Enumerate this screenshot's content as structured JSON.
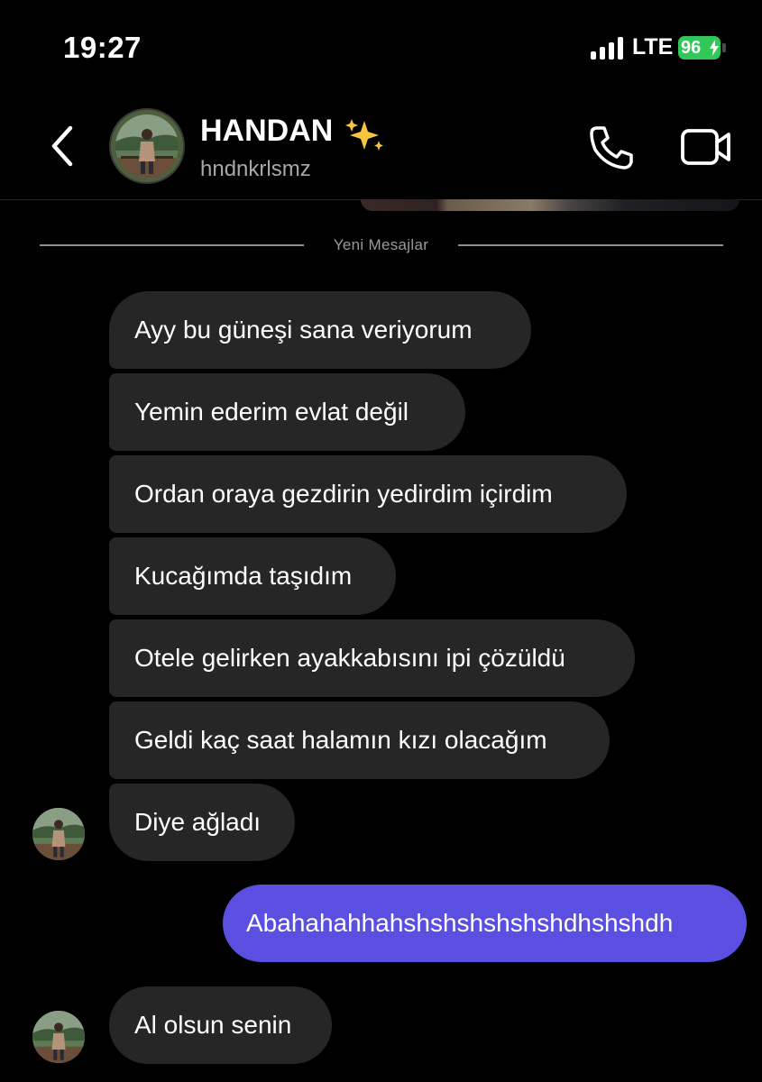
{
  "status_bar": {
    "time": "19:27",
    "network": "LTE",
    "battery": "96"
  },
  "header": {
    "name": "HANDAN",
    "name_emoji_icon": "sparkles-icon",
    "username": "hndnkrlsmz",
    "back_icon": "chevron-left-icon",
    "call_icon": "phone-icon",
    "video_icon": "video-camera-icon"
  },
  "divider": {
    "label": "Yeni Mesajlar"
  },
  "messages": [
    {
      "from": "them",
      "text": "Ayy bu güneşi sana veriyorum"
    },
    {
      "from": "them",
      "text": "Yemin ederim evlat değil"
    },
    {
      "from": "them",
      "text": "Ordan oraya gezdirin yedirdim içirdim"
    },
    {
      "from": "them",
      "text": "Kucağımda taşıdım"
    },
    {
      "from": "them",
      "text": "Otele gelirken ayakkabısını ipi çözüldü"
    },
    {
      "from": "them",
      "text": "Geldi kaç saat halamın kızı olacağım"
    },
    {
      "from": "them",
      "text": "Diye ağladı"
    },
    {
      "from": "me",
      "text": "Abahahahhahshshshshshshdhshshdh"
    },
    {
      "from": "them",
      "text": "Al olsun senin"
    }
  ],
  "colors": {
    "background": "#000000",
    "received_bubble": "#262626",
    "sent_bubble": "#5a4fe0",
    "battery": "#32c759"
  }
}
